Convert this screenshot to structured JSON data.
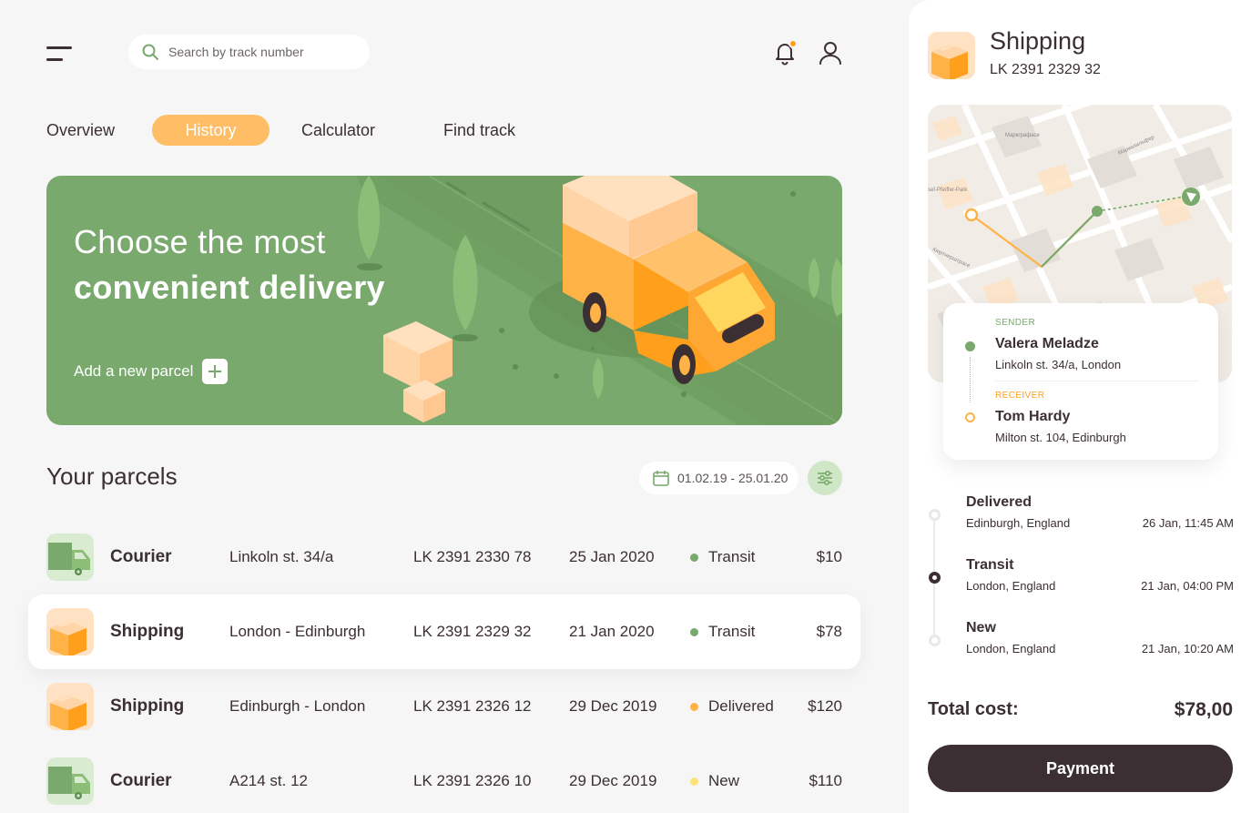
{
  "header": {
    "search_placeholder": "Search by track number",
    "notification_dot_color": "#ff9f1c"
  },
  "tabs": [
    {
      "label": "Overview",
      "active": false
    },
    {
      "label": "History",
      "active": true
    },
    {
      "label": "Calculator",
      "active": false
    },
    {
      "label": "Find track",
      "active": false
    }
  ],
  "hero": {
    "title_light": "Choose the most",
    "title_bold": "convenient delivery",
    "add_label": "Add a new parcel"
  },
  "parcels": {
    "title": "Your parcels",
    "date_range": "01.02.19 - 25.01.20",
    "rows": [
      {
        "type": "Courier",
        "route": "Linkoln st. 34/a",
        "track": "LK 2391 2330 78",
        "date": "25 Jan 2020",
        "status": "Transit",
        "status_color": "#79a96c",
        "price": "$10",
        "icon": "courier-truck-icon"
      },
      {
        "type": "Shipping",
        "route": "London - Edinburgh",
        "track": "LK 2391 2329 32",
        "date": "21 Jan 2020",
        "status": "Transit",
        "status_color": "#79a96c",
        "price": "$78",
        "icon": "shipping-box-icon"
      },
      {
        "type": "Shipping",
        "route": "Edinburgh - London",
        "track": "LK 2391 2326 12",
        "date": "29 Dec 2019",
        "status": "Delivered",
        "status_color": "#ffb347",
        "price": "$120",
        "icon": "shipping-box-icon"
      },
      {
        "type": "Courier",
        "route": "A214 st. 12",
        "track": "LK 2391 2326 10",
        "date": "29 Dec 2019",
        "status": "New",
        "status_color": "#ffe27a",
        "price": "$110",
        "icon": "courier-truck-icon"
      }
    ]
  },
  "details": {
    "title": "Shipping",
    "track": "LK 2391 2329 32",
    "map_labels": [
      "Маркграфасе",
      "Мариахильфер",
      "sef-Pfeiffer-Park",
      "Кюртнерштрасе"
    ],
    "sender_label": "SENDER",
    "sender_name": "Valera Meladze",
    "sender_address": "Linkoln st. 34/a, London",
    "receiver_label": "RECEIVER",
    "receiver_name": "Tom Hardy",
    "receiver_address": "Milton st. 104, Edinburgh",
    "timeline": [
      {
        "title": "Delivered",
        "location": "Edinburgh, England",
        "time": "26 Jan, 11:45 AM",
        "state": "done"
      },
      {
        "title": "Transit",
        "location": "London, England",
        "time": "21 Jan, 04:00 PM",
        "state": "current"
      },
      {
        "title": "New",
        "location": "London, England",
        "time": "21 Jan, 10:20 AM",
        "state": "done"
      }
    ],
    "total_label": "Total cost:",
    "total_value": "$78,00",
    "pay_label": "Payment"
  },
  "colors": {
    "accent_orange": "#ffbd66",
    "brand_green": "#79a96c",
    "dark": "#3b2f33"
  }
}
